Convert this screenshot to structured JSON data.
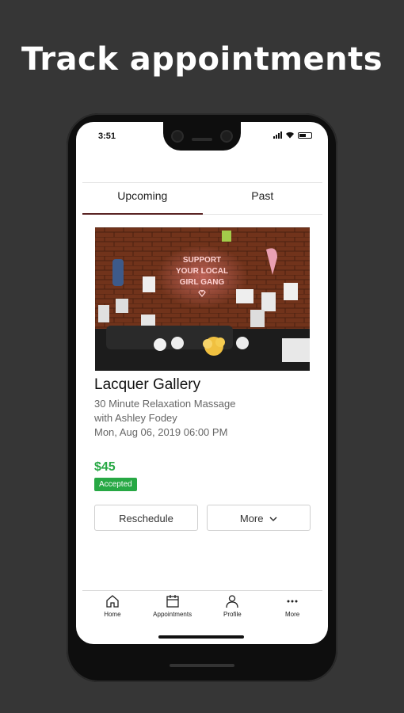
{
  "headline": "Track appointments",
  "status_bar": {
    "time": "3:51"
  },
  "tabs": [
    {
      "label": "Upcoming",
      "active": true
    },
    {
      "label": "Past",
      "active": false
    }
  ],
  "appointment": {
    "photo_neon_text": "SUPPORT YOUR LOCAL GIRL GANG",
    "venue": "Lacquer Gallery",
    "service": "30 Minute Relaxation Massage",
    "provider": "with Ashley Fodey",
    "datetime": "Mon, Aug 06, 2019 06:00 PM",
    "price": "$45",
    "status": "Accepted",
    "reschedule_label": "Reschedule",
    "more_label": "More"
  },
  "bottom_nav": [
    {
      "label": "Home",
      "icon": "home-icon"
    },
    {
      "label": "Appointments",
      "icon": "calendar-icon"
    },
    {
      "label": "Profile",
      "icon": "person-icon"
    },
    {
      "label": "More",
      "icon": "ellipsis-icon"
    }
  ],
  "colors": {
    "accent_green": "#27a844",
    "tab_indicator": "#5a2424",
    "background": "#363636"
  }
}
